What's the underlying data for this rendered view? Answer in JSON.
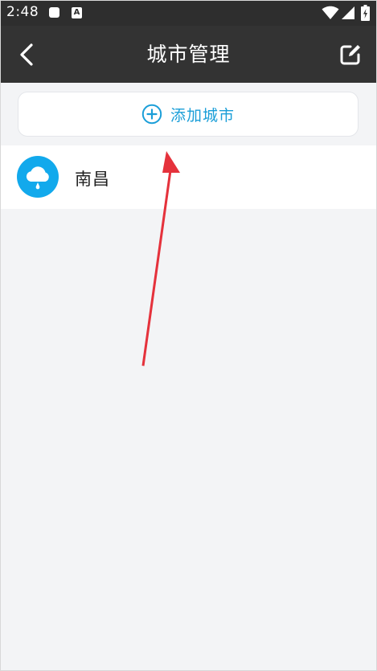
{
  "status_bar": {
    "time": "2:48",
    "icons": [
      "square-notification-icon",
      "a-notification-icon",
      "wifi-icon",
      "signal-icon",
      "battery-icon"
    ]
  },
  "header": {
    "title": "城市管理",
    "back_icon": "chevron-left-icon",
    "edit_icon": "edit-icon"
  },
  "add_city": {
    "label": "添加城市",
    "icon": "plus-circle-icon"
  },
  "cities": [
    {
      "name": "南昌",
      "icon": "cloud-rain-icon"
    }
  ],
  "colors": {
    "header_bg": "#333333",
    "status_bar_bg": "#2e2e2e",
    "accent": "#1a9ed8",
    "avatar_bg": "#12a9ec",
    "page_bg": "#f3f4f6",
    "annotation_arrow": "#e5323c"
  }
}
